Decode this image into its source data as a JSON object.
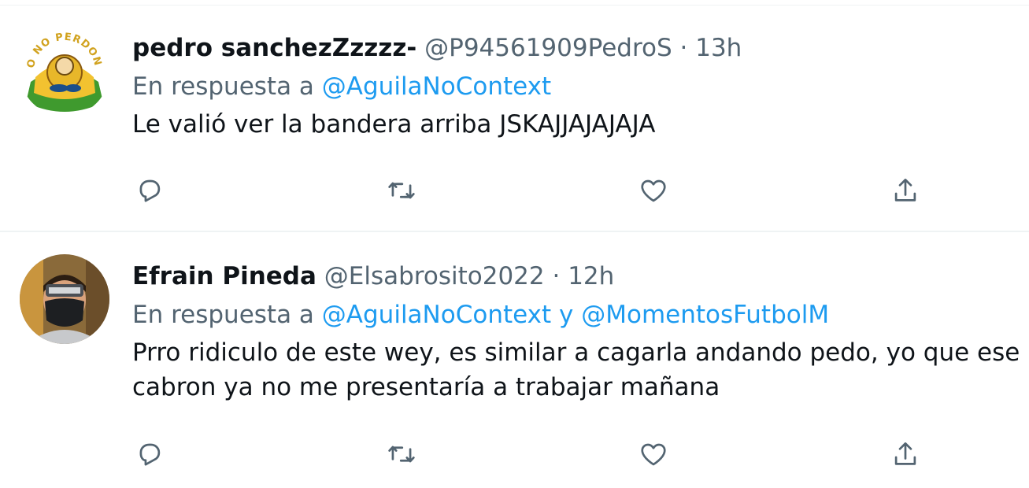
{
  "tweets": [
    {
      "name": "pedro sanchezZzzzz-",
      "handle": "@P94561909PedroS",
      "separator": "·",
      "time": "13h",
      "reply_prefix": "En respuesta a",
      "mentions": [
        "@AguilaNoContext"
      ],
      "text": "Le valió ver la bandera arriba JSKAJJAJAJAJA",
      "avatar": {
        "label": "YO NO PERDONO"
      }
    },
    {
      "name": "Efrain Pineda",
      "handle": "@Elsabrosito2022",
      "separator": "·",
      "time": "12h",
      "reply_prefix": "En respuesta a",
      "mentions": [
        "@AguilaNoContext",
        "@MomentosFutbolM"
      ],
      "mention_joiner": "y",
      "text_line1": "Prro ridiculo de este wey, es similar a cagarla andando pedo, yo que ese",
      "text_line2": "cabron ya no me presentaría a trabajar mañana"
    }
  ],
  "icons": {
    "reply": "reply-icon",
    "retweet": "retweet-icon",
    "like": "heart-icon",
    "share": "share-icon"
  },
  "colors": {
    "link": "#1d9bf0",
    "secondary_text": "#536471",
    "primary_text": "#0f1419",
    "divider": "#eff3f4"
  }
}
